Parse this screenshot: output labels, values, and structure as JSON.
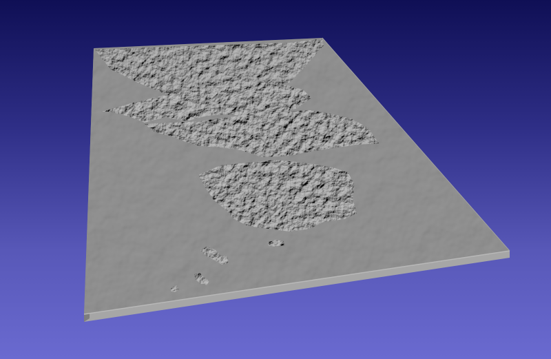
{
  "viewer": {
    "background_top": "#0f0f55",
    "background_bottom": "#6a6ad0",
    "model": {
      "kind": "terrain-relief-block",
      "surface_color": "#8c8c8c",
      "side_color": "#a5a5a5",
      "edge_color": "#b8b8b8",
      "relief_highlight": "#c2c2c2",
      "relief_shadow": "#4a4a4a"
    }
  }
}
